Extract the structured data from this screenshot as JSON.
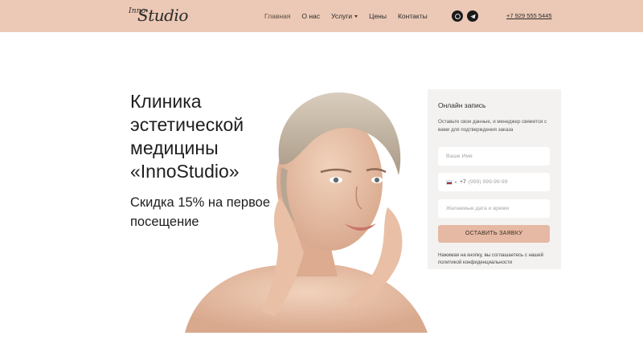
{
  "header": {
    "logo": {
      "small": "Inno",
      "big": "Studio"
    },
    "nav": [
      {
        "label": "Главная",
        "active": true
      },
      {
        "label": "О нас"
      },
      {
        "label": "Услуги",
        "has_dropdown": true
      },
      {
        "label": "Цены"
      },
      {
        "label": "Контакты"
      }
    ],
    "social": [
      {
        "icon": "whatsapp-icon"
      },
      {
        "icon": "telegram-icon"
      }
    ],
    "phone": "+7 929 555 5445"
  },
  "hero": {
    "title": "Клиника эстетической медицины «InnoStudio»",
    "subtitle": "Скидка 15% на первое посещение"
  },
  "form": {
    "title": "Онлайн запись",
    "description": "Оставьте свои данные, и менеджер свяжется с вами для подтверждения заказа",
    "name_placeholder": "Ваше Имя",
    "phone_code": "+7",
    "phone_placeholder": "(999) 999-99-99",
    "date_placeholder": "Желаемые дата и время",
    "submit_label": "ОСТАВИТЬ ЗАЯВКУ",
    "consent": "Нажимая на кнопку, вы соглашаетесь с нашей политикой конфиденциальности"
  },
  "colors": {
    "header_bg": "#ecc9b6",
    "button_bg": "#e5b9a3",
    "form_bg": "#f4f2f1",
    "text_dark": "#1e1e1e"
  }
}
